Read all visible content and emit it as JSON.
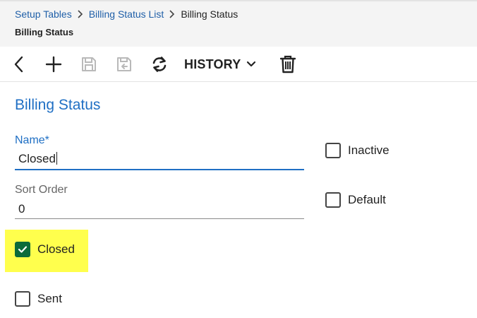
{
  "breadcrumb": {
    "items": [
      {
        "label": "Setup Tables"
      },
      {
        "label": "Billing Status List"
      },
      {
        "label": "Billing Status"
      }
    ]
  },
  "header": {
    "title": "Billing Status"
  },
  "toolbar": {
    "back_icon": "chevron-left-icon",
    "add_icon": "plus-icon",
    "save_icon": "save-icon",
    "save_close_icon": "save-and-close-icon",
    "refresh_icon": "refresh-icon",
    "history_label": "HISTORY",
    "delete_icon": "trash-icon"
  },
  "form": {
    "section_title": "Billing Status",
    "name": {
      "label": "Name*",
      "value": "Closed"
    },
    "sort_order": {
      "label": "Sort Order",
      "value": "0"
    },
    "checkboxes": {
      "inactive": {
        "label": "Inactive",
        "checked": false
      },
      "default": {
        "label": "Default",
        "checked": false
      },
      "closed": {
        "label": "Closed",
        "checked": true
      },
      "sent": {
        "label": "Sent",
        "checked": false
      }
    }
  },
  "colors": {
    "accent": "#1f6fc4",
    "link": "#1f5fa8",
    "checked": "#0b6b3a",
    "highlight": "#ffff4d",
    "header_bg": "#f4f4f4"
  }
}
